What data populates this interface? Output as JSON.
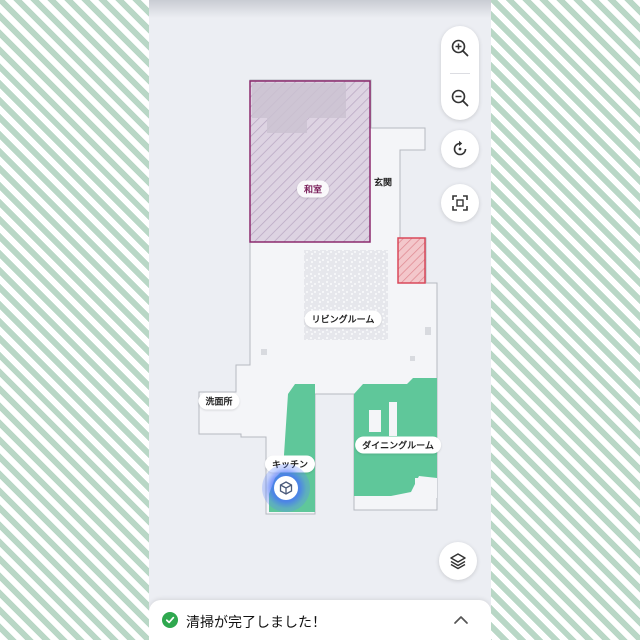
{
  "map": {
    "rooms": [
      {
        "id": "washitsu",
        "label": "和室",
        "style": "zone"
      },
      {
        "id": "genkan",
        "label": "玄関",
        "style": "plain"
      },
      {
        "id": "living",
        "label": "リビングルーム",
        "style": "pill"
      },
      {
        "id": "senmenjo",
        "label": "洗面所",
        "style": "pill"
      },
      {
        "id": "kitchen",
        "label": "キッチン",
        "style": "pill"
      },
      {
        "id": "dining",
        "label": "ダイニングルーム",
        "style": "pill"
      }
    ],
    "no_go_zone_color": "#8b2a6e",
    "restricted_zone_color": "#d9485a",
    "cleaned_area_color": "#5fc79a",
    "robot_color": "#4f74ff"
  },
  "controls": {
    "zoom_in": "zoom-in-icon",
    "zoom_out": "zoom-out-icon",
    "rotate": "rotate-icon",
    "fit": "fit-screen-icon",
    "layers": "layers-icon"
  },
  "banner": {
    "message": "清掃が完了しました！",
    "status_color": "#2fa84f"
  }
}
